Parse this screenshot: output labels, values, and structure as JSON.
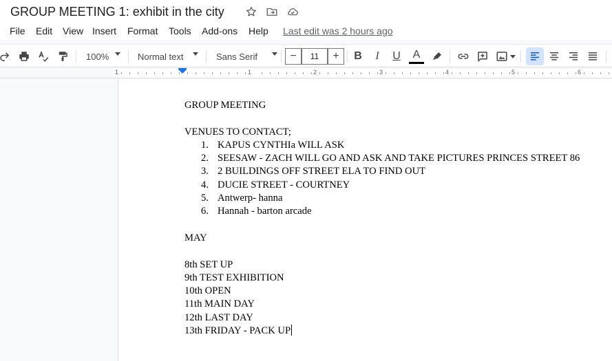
{
  "doc": {
    "title": "GROUP MEETING 1: exhibit in the city",
    "last_edit": "Last edit was 2 hours ago"
  },
  "menu": {
    "file": "File",
    "edit": "Edit",
    "view": "View",
    "insert": "Insert",
    "format": "Format",
    "tools": "Tools",
    "addons": "Add-ons",
    "help": "Help"
  },
  "toolbar": {
    "zoom": "100%",
    "style": "Normal text",
    "font": "Sans Serif",
    "font_size": "11",
    "minus": "−",
    "plus": "+",
    "bold": "B",
    "italic": "I",
    "underline": "U",
    "text_color_letter": "A",
    "text_color": "#000000"
  },
  "ruler": {
    "numbers": [
      "1",
      "1",
      "2",
      "3",
      "4",
      "5",
      "6"
    ]
  },
  "content": {
    "heading": "GROUP MEETING",
    "venues_label": "VENUES TO CONTACT;",
    "venues": [
      {
        "num": "1.",
        "text": "KAPUS CYNTHIa WILL ASK"
      },
      {
        "num": "2.",
        "text": "SEESAW - ZACH WILL GO AND ASK AND TAKE PICTURES  PRINCES STREET 86"
      },
      {
        "num": "3.",
        "text": "2 BUILDINGS OFF STREET ELA TO FIND OUT"
      },
      {
        "num": "4.",
        "text": "DUCIE STREET - COURTNEY"
      },
      {
        "num": "5.",
        "text": "Antwerp- hanna"
      },
      {
        "num": "6.",
        "text": "Hannah - barton arcade"
      }
    ],
    "month": "MAY",
    "schedule": [
      "8th SET UP",
      "9th TEST EXHIBITION",
      "10th OPEN",
      "11th MAIN DAY",
      "12th LAST DAY",
      "13th FRIDAY - PACK UP"
    ]
  },
  "icons": {
    "star": "star-icon",
    "move": "move-to-folder-icon",
    "cloud": "cloud-saved-icon"
  },
  "colors": {
    "accent": "#1a73e8",
    "align_active_bg": "#d3e3fd"
  }
}
